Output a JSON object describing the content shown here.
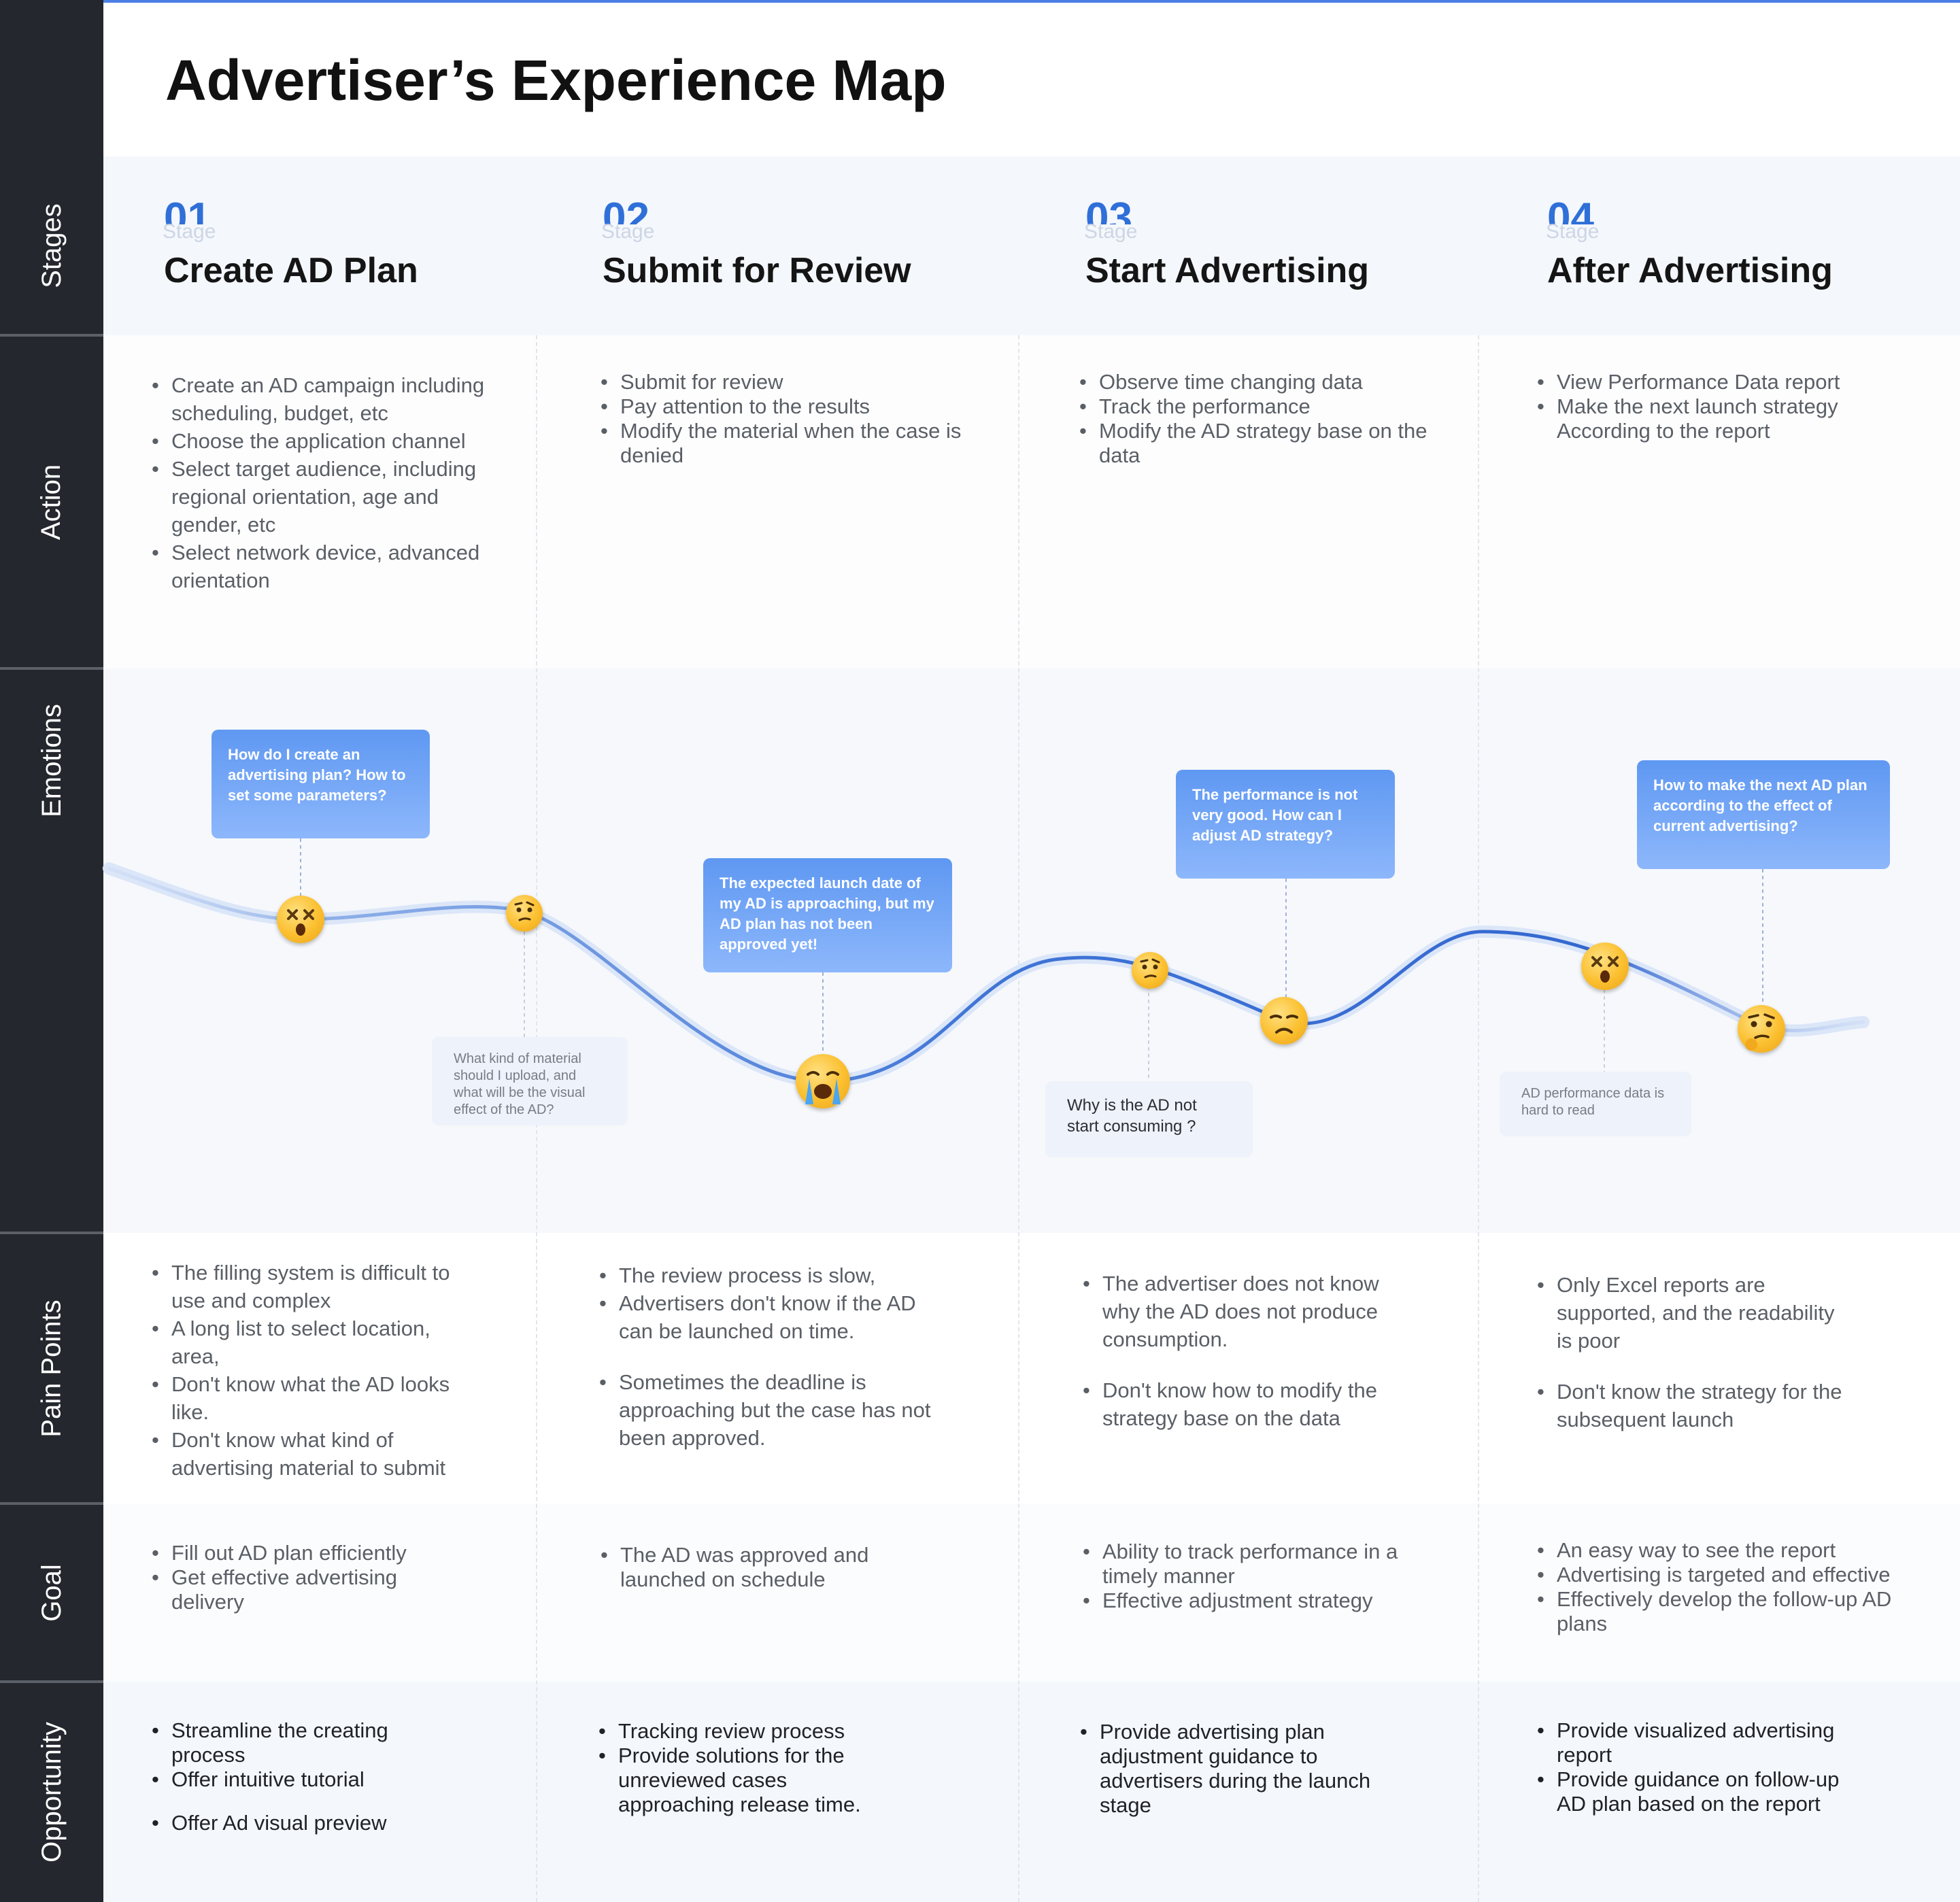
{
  "title": "Advertiser’s Experience Map",
  "row_labels": [
    "Stages",
    "Action",
    "Emotions",
    "Pain Points",
    "Goal",
    "Opportunity"
  ],
  "stage_caption": "Stage",
  "stages": [
    {
      "num": "01",
      "name": "Create AD Plan"
    },
    {
      "num": "02",
      "name": "Submit for Review"
    },
    {
      "num": "03",
      "name": "Start Advertising"
    },
    {
      "num": "04",
      "name": "After Advertising"
    }
  ],
  "actions": [
    [
      "Create an AD campaign including scheduling, budget, etc",
      "Choose the application channel",
      "Select target audience, including regional orientation, age and gender, etc",
      "Select network device, advanced orientation"
    ],
    [
      "Submit for review",
      "Pay attention to the results",
      "Modify the material when the case is denied"
    ],
    [
      "Observe time changing data",
      "Track the performance",
      "Modify the AD strategy base on the data"
    ],
    [
      "View Performance Data report",
      "Make the next launch strategy According to the report"
    ]
  ],
  "emotion_bubbles": [
    "How do I create an advertising plan? How to set some parameters?",
    "The expected launch date of my AD is approaching, but my AD plan has not been approved yet!",
    "The performance is not very good. How can I adjust AD strategy?",
    "How to make the next AD plan according to the effect of current advertising?"
  ],
  "emotion_notes": [
    "What kind of material should I upload, and what will be the visual effect of the AD?",
    "Why is the AD not start consuming ?",
    "AD performance data is hard to read"
  ],
  "emotion_icons": [
    "dizzy-face-icon",
    "thinking-face-icon",
    "crying-face-icon",
    "thinking-face-icon",
    "sad-face-icon",
    "dizzy-face-icon",
    "thinking-face-icon"
  ],
  "pain_points": [
    [
      "The filling system is difficult to use and complex",
      "A long list to select location, area,",
      "Don't know what the AD looks like.",
      "Don't know what kind of advertising material to submit"
    ],
    [
      "The review process is slow,",
      "Advertisers don't know if the AD can be launched on time.",
      "Sometimes the deadline is approaching but the case has not been approved."
    ],
    [
      "The advertiser does not know why the AD does not produce consumption.",
      "Don't know how to modify the strategy base on the data"
    ],
    [
      "Only Excel reports are supported, and the readability is poor",
      "Don't know the strategy for the subsequent launch"
    ]
  ],
  "goals": [
    [
      "Fill out AD plan efficiently",
      "Get effective advertising delivery"
    ],
    [
      "The AD was approved and launched on schedule"
    ],
    [
      "Ability to track performance in a timely manner",
      "Effective adjustment strategy"
    ],
    [
      "An easy way to see the report",
      "Advertising is targeted and effective",
      "Effectively develop the follow-up AD plans"
    ]
  ],
  "opportunities": [
    [
      "Streamline the creating process",
      "Offer intuitive tutorial",
      "Offer Ad visual preview"
    ],
    [
      "Tracking review process",
      "Provide solutions for the unreviewed cases approaching release time."
    ],
    [
      "Provide advertising plan adjustment guidance to advertisers during the launch stage"
    ],
    [
      "Provide visualized advertising report",
      "Provide guidance on follow-up AD plan based on the report"
    ]
  ],
  "colors": {
    "accent": "#2f6fd8",
    "curve": "#3f74d6",
    "sidebar": "#24272d",
    "bubble": "#6ea2f5"
  }
}
